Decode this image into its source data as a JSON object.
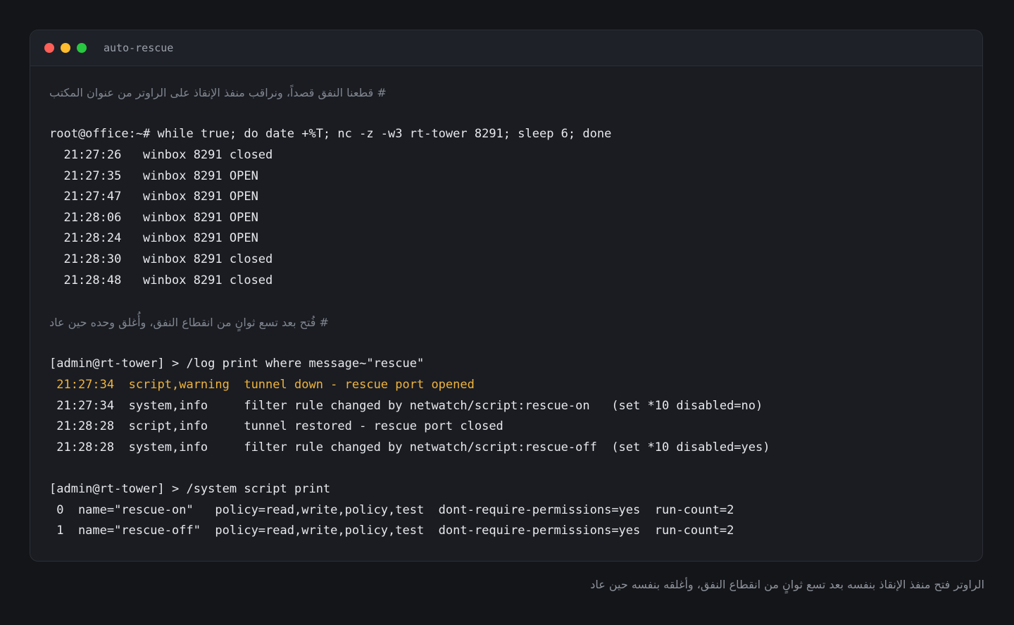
{
  "window": {
    "title": "auto-rescue"
  },
  "terminal": {
    "comment_1": "# قطعنا النفق قصداً، ونراقب منفذ الإنقاذ على الراوتر من عنوان المكتب",
    "cmd_1": "root@office:~# while true; do date +%T; nc -z -w3 rt-tower 8291; sleep 6; done",
    "probe_lines": [
      "  21:27:26   winbox 8291 closed",
      "  21:27:35   winbox 8291 OPEN",
      "  21:27:47   winbox 8291 OPEN",
      "  21:28:06   winbox 8291 OPEN",
      "  21:28:24   winbox 8291 OPEN",
      "  21:28:30   winbox 8291 closed",
      "  21:28:48   winbox 8291 closed"
    ],
    "comment_2": "# فُتح بعد تسع ثوانٍ من انقطاع النفق، وأُغلق وحده حين عاد",
    "cmd_2": "[admin@rt-tower] > /log print where message~\"rescue\"",
    "log_lines": [
      " 21:27:34  script,warning  tunnel down - rescue port opened",
      " 21:27:34  system,info     filter rule changed by netwatch/script:rescue-on   (set *10 disabled=no)",
      " 21:28:28  script,info     tunnel restored - rescue port closed",
      " 21:28:28  system,info     filter rule changed by netwatch/script:rescue-off  (set *10 disabled=yes)"
    ],
    "cmd_3": "[admin@rt-tower] > /system script print",
    "script_lines": [
      " 0  name=\"rescue-on\"   policy=read,write,policy,test  dont-require-permissions=yes  run-count=2",
      " 1  name=\"rescue-off\"  policy=read,write,policy,test  dont-require-permissions=yes  run-count=2"
    ]
  },
  "caption": "الراوتر فتح منفذ الإنقاذ بنفسه بعد تسع ثوانٍ من انقطاع النفق، وأغلقه بنفسه حين عاد",
  "colors": {
    "warning": "#f0b43c",
    "comment": "#80858f",
    "text": "#e6e8ec"
  }
}
